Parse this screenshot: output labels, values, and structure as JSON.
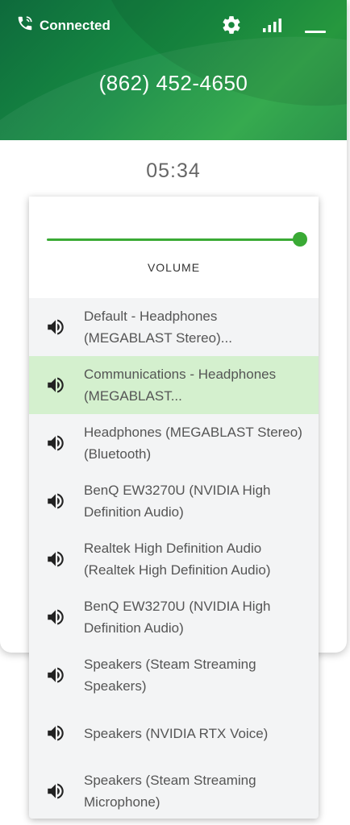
{
  "header": {
    "status": "Connected",
    "phone_number": "(862) 452-4650",
    "colors": {
      "gradient_dark": "#0e6a3c",
      "gradient_light": "#2aa544"
    }
  },
  "call": {
    "timer": "05:34"
  },
  "volume": {
    "label": "VOLUME",
    "level": 1.0,
    "accent": "#3aaa35"
  },
  "devices": [
    {
      "label": "Default - Headphones (MEGABLAST Stereo)...",
      "icon": "speaker-icon"
    },
    {
      "label": "Communications - Headphones (MEGABLAST...",
      "icon": "speaker-icon",
      "selected": true
    },
    {
      "label": "Headphones (MEGABLAST Stereo) (Bluetooth)",
      "icon": "speaker-icon"
    },
    {
      "label": "BenQ EW3270U (NVIDIA High Definition Audio)",
      "icon": "speaker-icon"
    },
    {
      "label": "Realtek High Definition Audio (Realtek High Definition Audio)",
      "icon": "speaker-icon"
    },
    {
      "label": "BenQ EW3270U (NVIDIA High Definition Audio)",
      "icon": "speaker-icon"
    },
    {
      "label": "Speakers (Steam Streaming Speakers)",
      "icon": "speaker-icon"
    },
    {
      "label": "Speakers (NVIDIA RTX Voice)",
      "icon": "speaker-icon"
    },
    {
      "label": "Speakers (Steam Streaming Microphone)",
      "icon": "speaker-icon"
    }
  ]
}
